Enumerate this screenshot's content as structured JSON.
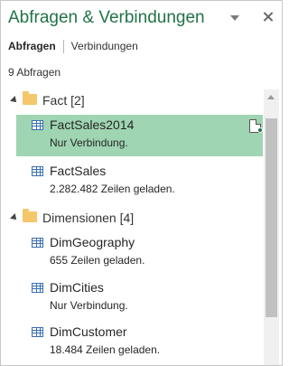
{
  "header": {
    "title": "Abfragen & Verbindungen",
    "dropdown_icon": "chevron-down-icon",
    "close_icon": "close-icon"
  },
  "tabs": [
    {
      "label": "Abfragen",
      "active": true
    },
    {
      "label": "Verbindungen",
      "active": false
    }
  ],
  "query_count": "9 Abfragen",
  "groups": [
    {
      "label": "Fact [2]",
      "icon": "folder-icon",
      "queries": [
        {
          "name": "FactSales2014",
          "status": "Nur Verbindung.",
          "selected": true,
          "icon": "table-icon"
        },
        {
          "name": "FactSales",
          "status": "2.282.482 Zeilen geladen.",
          "selected": false,
          "icon": "table-icon"
        }
      ]
    },
    {
      "label": "Dimensionen [4]",
      "icon": "folder-icon",
      "queries": [
        {
          "name": "DimGeography",
          "status": "655 Zeilen geladen.",
          "selected": false,
          "icon": "table-icon"
        },
        {
          "name": "DimCities",
          "status": "Nur Verbindung.",
          "selected": false,
          "icon": "table-icon"
        },
        {
          "name": "DimCustomer",
          "status": "18.484 Zeilen geladen.",
          "selected": false,
          "icon": "table-icon"
        }
      ]
    }
  ],
  "colors": {
    "title": "#217346",
    "selected_row": "#9fd5b2"
  }
}
